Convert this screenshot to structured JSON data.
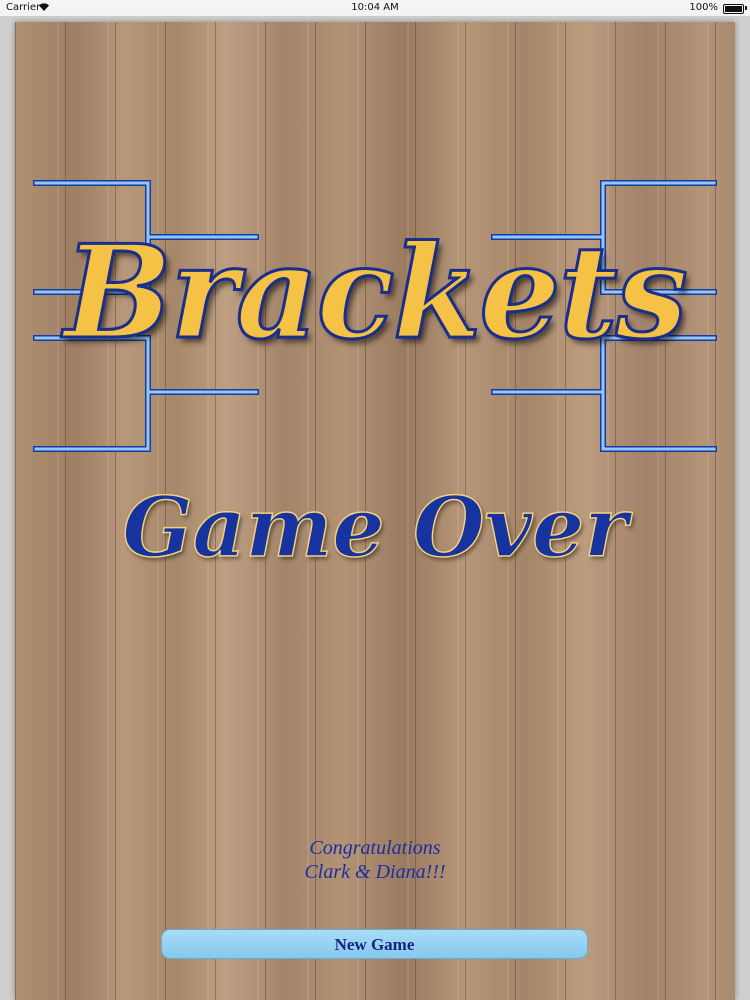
{
  "status_bar": {
    "carrier": "Carrier",
    "time": "10:04 AM",
    "battery": "100%"
  },
  "title": "Brackets",
  "subtitle": "Game Over",
  "congrats": {
    "line1": "Congratulations",
    "line2": "Clark & Diana!!!"
  },
  "new_game_label": "New Game",
  "colors": {
    "title_fill": "#f5c245",
    "title_outline": "#1a2f8c",
    "subtitle_fill": "#1733a0",
    "bracket_line": "#8fc8f2",
    "button_fill": "#97d2f3"
  }
}
